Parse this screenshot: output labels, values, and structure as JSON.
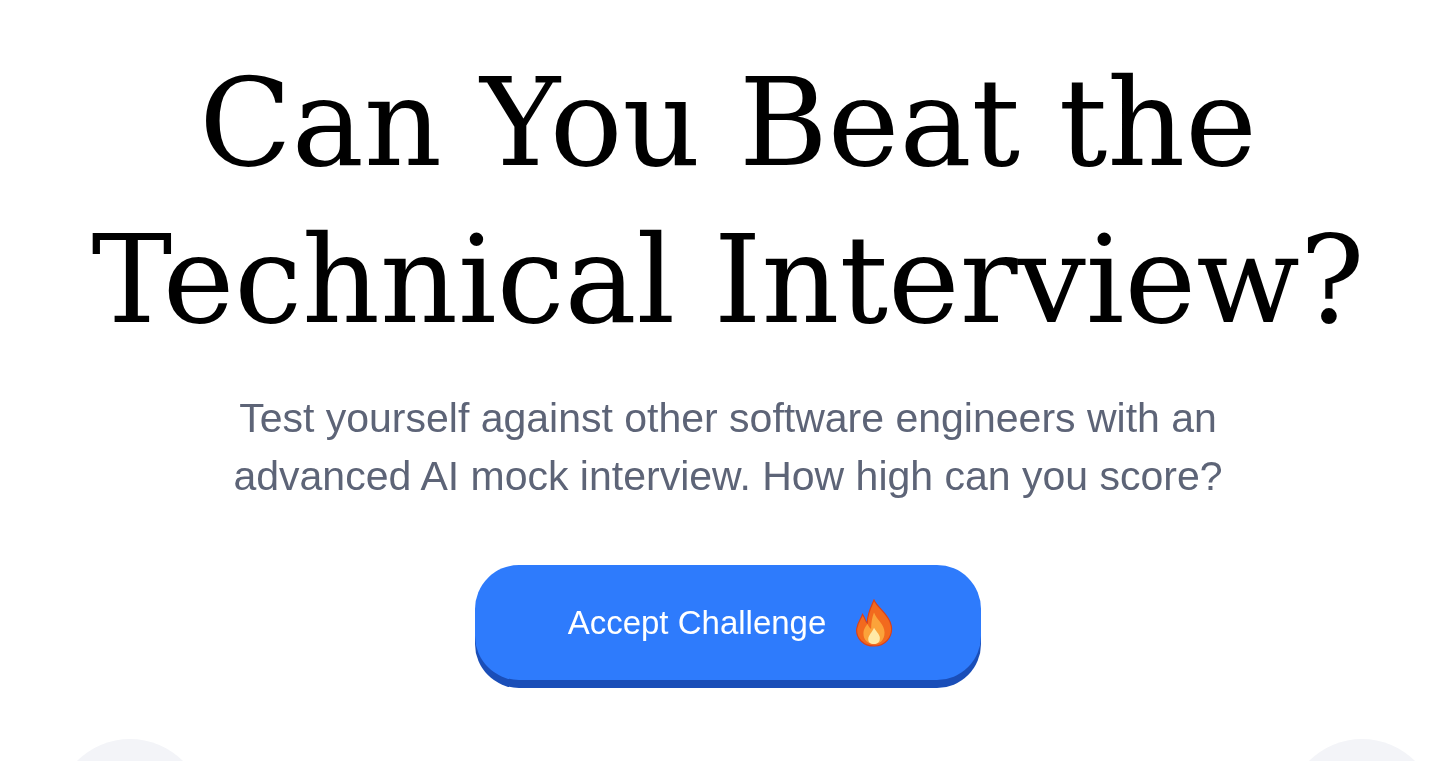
{
  "hero": {
    "title": "Can You Beat the Technical Interview?",
    "subtitle": "Test yourself against other software engineers with an advanced AI mock interview. How high can you score?",
    "cta_button": {
      "label": "Accept Challenge"
    }
  }
}
